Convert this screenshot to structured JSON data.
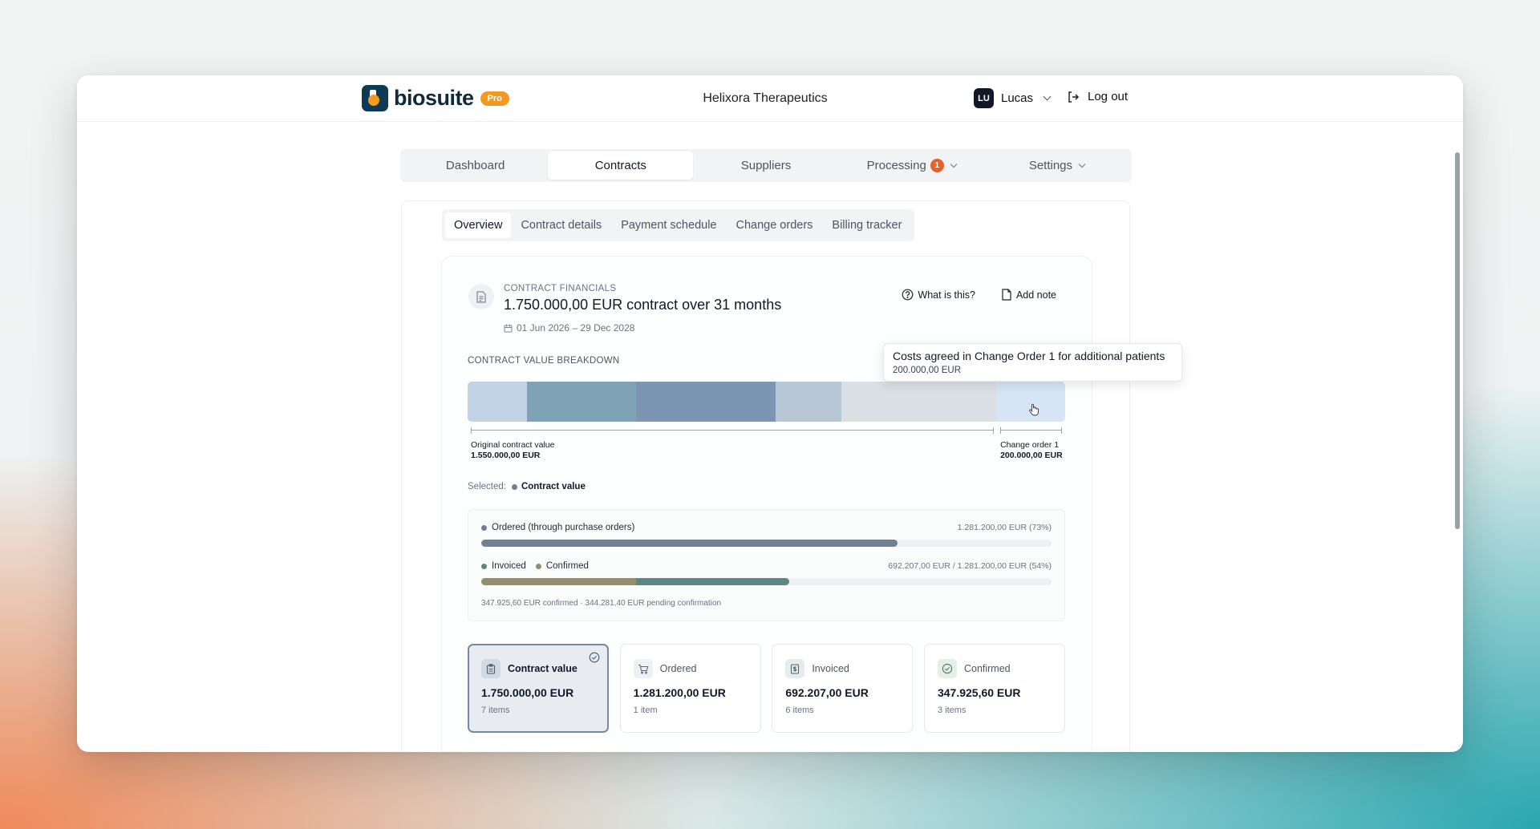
{
  "app": {
    "logo_text": "biosuite",
    "badge": "Pro",
    "org_name": "Helixora Therapeutics",
    "user_initials": "LU",
    "user_name": "Lucas",
    "logout_label": "Log out"
  },
  "nav": {
    "tabs": [
      "Dashboard",
      "Contracts",
      "Suppliers",
      "Processing",
      "Settings"
    ],
    "active": "Contracts",
    "processing_badge": "1"
  },
  "subtabs": {
    "items": [
      "Overview",
      "Contract details",
      "Payment schedule",
      "Change orders",
      "Billing tracker"
    ],
    "active": "Overview"
  },
  "financials": {
    "eyebrow": "CONTRACT FINANCIALS",
    "title": "1.750.000,00 EUR contract over 31 months",
    "date_range": "01 Jun 2026 – 29 Dec 2028",
    "what_is_this": "What is this?",
    "add_note": "Add note"
  },
  "breakdown": {
    "label": "CONTRACT VALUE BREAKDOWN",
    "segments": [
      {
        "share": 0.099,
        "color": "#c3d3e6"
      },
      {
        "share": 0.183,
        "color": "#7da3b5"
      },
      {
        "share": 0.233,
        "color": "#7b95b3"
      },
      {
        "share": 0.11,
        "color": "#b7c7d6"
      },
      {
        "share": 0.26,
        "color": "#d9dfe3"
      },
      {
        "share": 0.115,
        "color": "#d7e4f6"
      }
    ],
    "ranges": [
      {
        "label": "Original contract value",
        "value": "1.550.000,00 EUR",
        "share": 0.886
      },
      {
        "label": "Change order 1",
        "value": "200.000,00 EUR",
        "share": 0.114
      }
    ],
    "selected_label": "Selected:",
    "selected_value": "Contract value",
    "selected_color": "#6b7f95"
  },
  "tooltip": {
    "title": "Costs agreed in Change Order 1 for additional patients",
    "value": "200.000,00 EUR"
  },
  "progress": {
    "ordered": {
      "label": "Ordered (through purchase orders)",
      "amount": "1.281.200,00 EUR",
      "pct_label": "(73%)",
      "fraction": 0.73,
      "color": "#6f8095"
    },
    "invoiced": {
      "label_invoiced": "Invoiced",
      "label_confirmed": "Confirmed",
      "amount": "692.207,00 EUR / 1.281.200,00 EUR",
      "pct_label": "(54%)",
      "fraction": 0.54,
      "confirmed_fraction": 0.271,
      "color_invoiced": "#5c8585",
      "color_confirmed": "#948e6f"
    },
    "note": "347.925,60 EUR confirmed · 344.281,40 EUR pending confirmation"
  },
  "kpis": [
    {
      "label": "Contract value",
      "value": "1.750.000,00 EUR",
      "count": "7 items",
      "icon": "clipboard-icon",
      "selected": true
    },
    {
      "label": "Ordered",
      "value": "1.281.200,00 EUR",
      "count": "1 item",
      "icon": "cart-icon",
      "selected": false
    },
    {
      "label": "Invoiced",
      "value": "692.207,00 EUR",
      "count": "6 items",
      "icon": "invoice-icon",
      "selected": false
    },
    {
      "label": "Confirmed",
      "value": "347.925,60 EUR",
      "count": "3 items",
      "icon": "check-circle-icon",
      "selected": false
    }
  ]
}
